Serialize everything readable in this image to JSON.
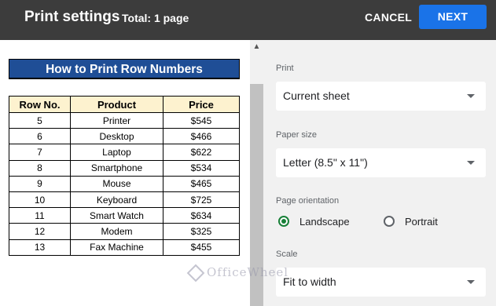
{
  "header": {
    "title": "Print settings",
    "total": "Total: 1 page",
    "cancel_label": "CANCEL",
    "next_label": "NEXT",
    "bg_color": "#3c3c3c",
    "accent_color": "#1a73e8"
  },
  "preview": {
    "sheet_title": "How to Print Row Numbers",
    "columns": [
      "Row No.",
      "Product",
      "Price"
    ],
    "rows": [
      [
        "5",
        "Printer",
        "$545"
      ],
      [
        "6",
        "Desktop",
        "$466"
      ],
      [
        "7",
        "Laptop",
        "$622"
      ],
      [
        "8",
        "Smartphone",
        "$534"
      ],
      [
        "9",
        "Mouse",
        "$465"
      ],
      [
        "10",
        "Keyboard",
        "$725"
      ],
      [
        "11",
        "Smart Watch",
        "$634"
      ],
      [
        "12",
        "Modem",
        "$325"
      ],
      [
        "13",
        "Fax Machine",
        "$455"
      ]
    ]
  },
  "settings": {
    "print_label": "Print",
    "print_value": "Current sheet",
    "paper_label": "Paper size",
    "paper_value": "Letter (8.5\" x 11\")",
    "orientation_label": "Page orientation",
    "landscape_label": "Landscape",
    "portrait_label": "Portrait",
    "orientation_selected": "Landscape",
    "scale_label": "Scale",
    "scale_value": "Fit to width"
  },
  "watermark": "OfficeWheel"
}
